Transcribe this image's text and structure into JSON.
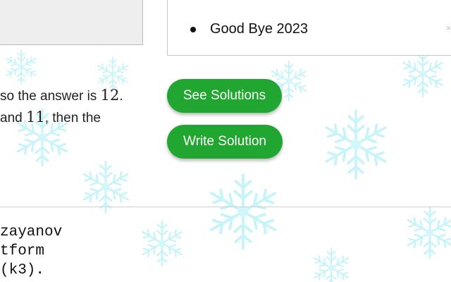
{
  "sidebar": {
    "contest_item": "Good Bye 2023",
    "dismiss_glyph": "×"
  },
  "problem": {
    "line1_prefix": "so the answer is ",
    "line1_math": "12",
    "line1_suffix": ".",
    "line2_prefix": "and ",
    "line2_math": "11",
    "line2_suffix": ", then the"
  },
  "actions": {
    "see_solutions": "See Solutions",
    "write_solution": "Write Solution"
  },
  "credits": {
    "line1": "zayanov",
    "line2": "tform",
    "line3": "(k3)."
  },
  "colors": {
    "button_green": "#22a632",
    "snowflake": "#c6f4f8"
  }
}
